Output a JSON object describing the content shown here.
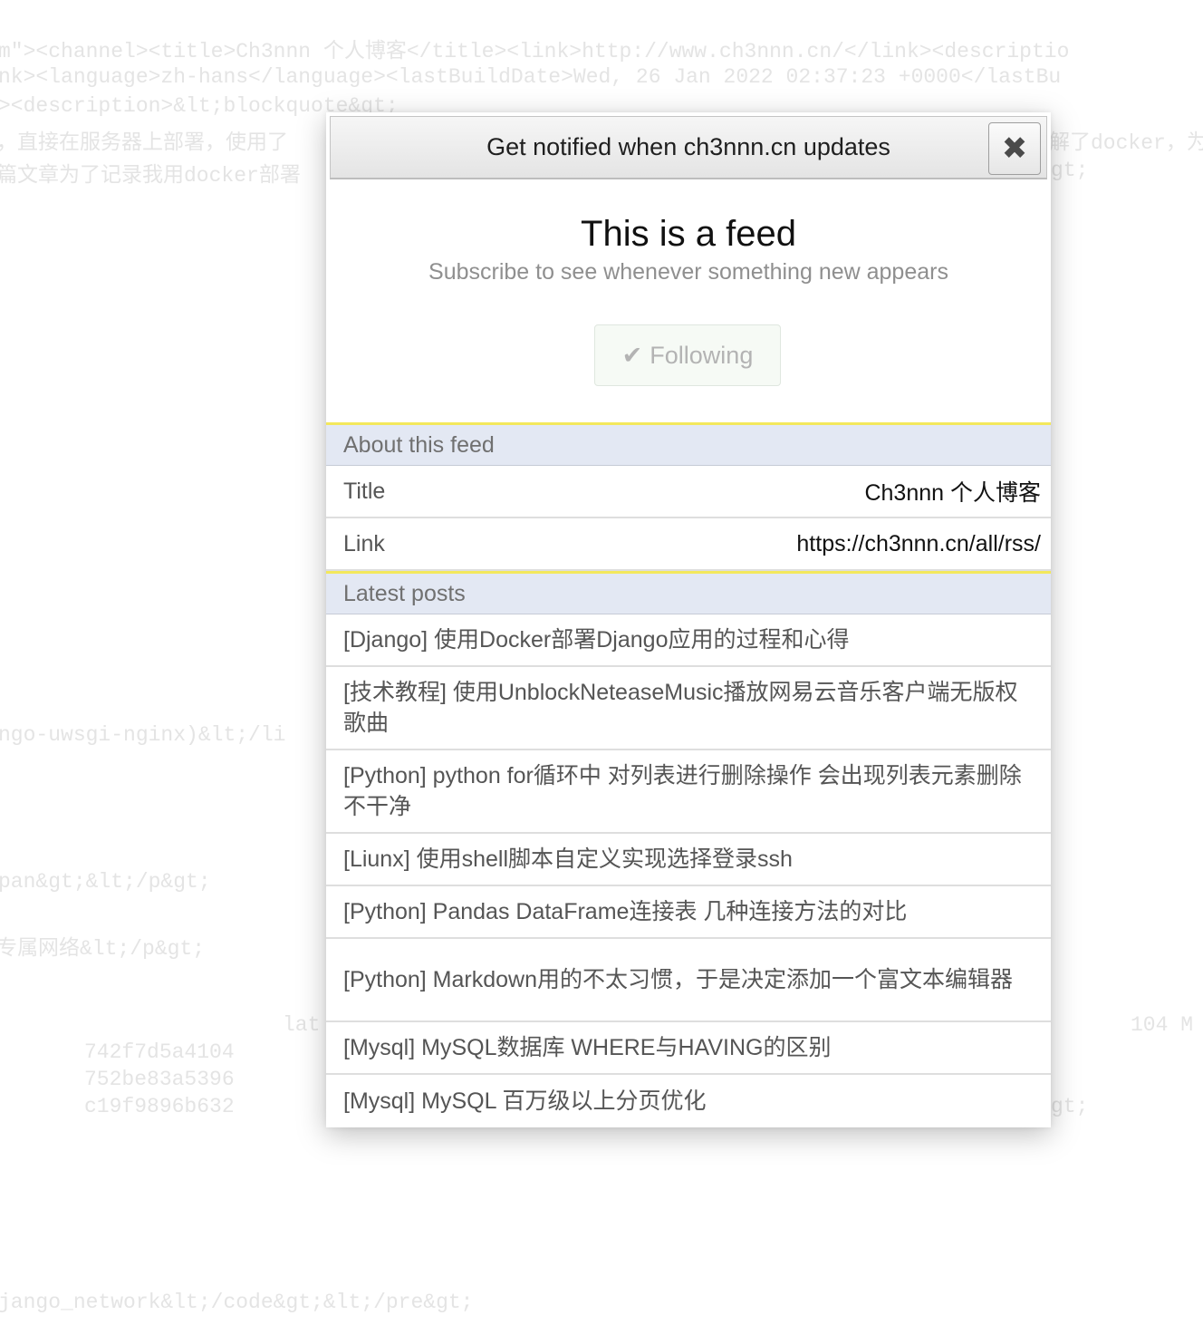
{
  "background_text": [
    "m\"><channel><title>Ch3nnn 个人博客</title><link>http://www.ch3nnn.cn/</link><descriptio",
    "nk><language>zh-hans</language><lastBuildDate>Wed, 26 Jan 2022 02:37:23 +0000</lastBu",
    "><description>&lt;blockquote&gt;",
    "，直接在服务器上部署，使用了",
    "解了docker，为",
    "篇文章为了记录我用docker部署",
    "gt;",
    "ngo-uwsgi-nginx)&lt;/li",
    "pan&gt;&lt;/p&gt;",
    "专属网络&lt;/p&gt;",
    "lat",
    "104 M",
    "742f7d5a4104",
    "752be83a5396",
    "c19f9896b632",
    "gt;",
    "jango_network&lt;/code&gt;&lt;/pre&gt;"
  ],
  "dialog": {
    "header_title": "Get notified when ch3nnn.cn updates",
    "close_icon": "✖",
    "heading": "This is a feed",
    "subheading": "Subscribe to see whenever something new appears",
    "follow_button": {
      "icon": "✔",
      "label": "Following",
      "state": "following"
    }
  },
  "about": {
    "section_title": "About this feed",
    "title_label": "Title",
    "title_value": "Ch3nnn 个人博客",
    "link_label": "Link",
    "link_value": "https://ch3nnn.cn/all/rss/"
  },
  "latest": {
    "section_title": "Latest posts",
    "posts": [
      "[Django] 使用Docker部署Django应用的过程和心得",
      "[技术教程] 使用UnblockNeteaseMusic播放网易云音乐客户端无版权歌曲",
      "[Python] python for循环中 对列表进行删除操作 会出现列表元素删除不干净",
      "[Liunx] 使用shell脚本自定义实现选择登录ssh",
      "[Python] Pandas DataFrame连接表 几种连接方法的对比",
      "[Python] Markdown用的不太习惯，于是决定添加一个富文本编辑器",
      "[Mysql] MySQL数据库 WHERE与HAVING的区别",
      "[Mysql] MySQL 百万级以上分页优化"
    ]
  },
  "colors": {
    "section_bg": "#e3e8f3",
    "section_top_accent": "#f3e85c",
    "follow_bg": "#f6faf5"
  }
}
